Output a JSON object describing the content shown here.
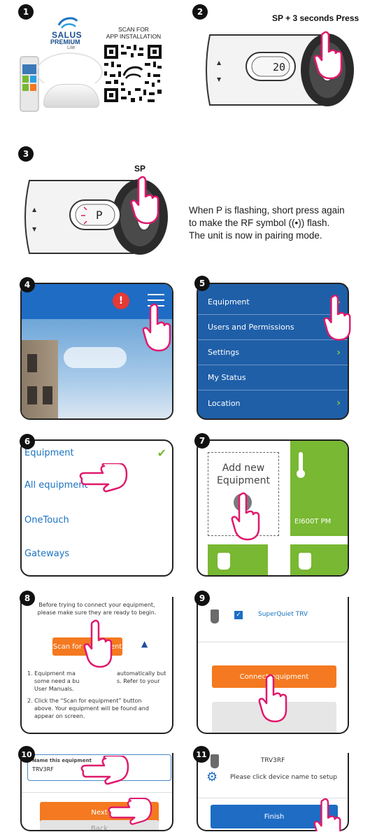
{
  "steps": [
    "1",
    "2",
    "3",
    "4",
    "5",
    "6",
    "7",
    "8",
    "9",
    "10",
    "11"
  ],
  "step1": {
    "brand": "SALUS",
    "brand_sub": "PREMIUM",
    "brand_lite": "Lite",
    "scan_text_line1": "SCAN FOR",
    "scan_text_line2": "APP INSTALLATION"
  },
  "step2": {
    "label": "SP + 3 seconds Press",
    "display": "20"
  },
  "step3": {
    "label": "SP",
    "display": "P",
    "text_line1": "When P is flashing, short press again",
    "text_line2": "to make the RF symbol ((•)) flash.",
    "text_line3": "The unit is now in pairing mode."
  },
  "step4": {
    "alert": "!"
  },
  "step5": {
    "menu": [
      "Equipment",
      "Users and Permissions",
      "Settings",
      "My Status",
      "Location"
    ]
  },
  "step6": {
    "items": [
      "Equipment",
      "All equipment",
      "OneTouch",
      "Gateways"
    ]
  },
  "step7": {
    "add_line1": "Add new",
    "add_line2": "Equipment",
    "device": "EI600T PM"
  },
  "step8": {
    "intro_line1": "Before trying to connect your equipment,",
    "intro_line2": "please make sure they are ready to begin.",
    "scan_button": "Scan for equipment",
    "item1_line1": "1. Equipment ma",
    "item1_line1b": "automatically but",
    "item1_line2": "some need a bu",
    "item1_line2b": "s. Refer to your",
    "item1_line3": "User Manuals.",
    "item2_line1": "2. Click the “Scan for equipment” button",
    "item2_line2": "above. Your equipment will be found and",
    "item2_line3": "appear on screen."
  },
  "step9": {
    "device": "SuperQuiet TRV",
    "connect_button": "Connect equipment"
  },
  "step10": {
    "field_label": "Name this equipment",
    "field_value": "TRV3RF",
    "next_button": "Next",
    "back_button": "Back"
  },
  "step11": {
    "device": "TRV3RF",
    "message": "Please click device name to setup",
    "finish_button": "Finish"
  },
  "colors": {
    "green": "#78b832",
    "orange": "#f47920",
    "blue": "#1e6cc4",
    "brand_blue": "#1b73c1"
  }
}
